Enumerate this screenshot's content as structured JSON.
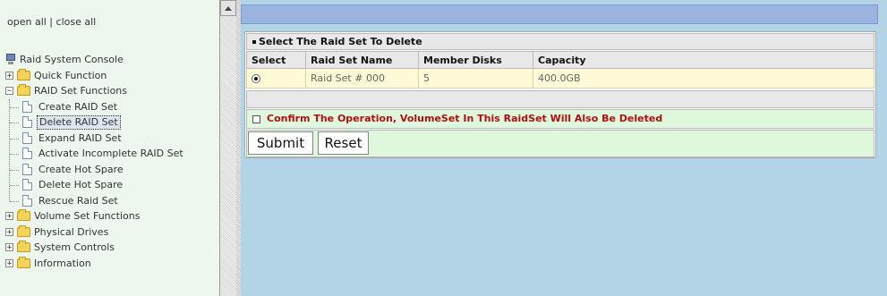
{
  "nav": {
    "open_all": "open all",
    "separator": " | ",
    "close_all": "close all"
  },
  "tree": {
    "root": "Raid System Console",
    "quick_function": "Quick Function",
    "raid_set_functions": "RAID Set Functions",
    "raid_items": [
      "Create RAID Set",
      "Delete RAID Set",
      "Expand RAID Set",
      "Activate Incomplete RAID Set",
      "Create Hot Spare",
      "Delete Hot Spare",
      "Rescue Raid Set"
    ],
    "volume_set_functions": "Volume Set Functions",
    "physical_drives": "Physical Drives",
    "system_controls": "System Controls",
    "information": "Information"
  },
  "panel": {
    "title": "Select The Raid Set To Delete",
    "columns": [
      "Select",
      "Raid Set Name",
      "Member Disks",
      "Capacity"
    ],
    "row": {
      "name": "Raid Set # 000",
      "member_disks": "5",
      "capacity": "400.0GB"
    },
    "confirm_text": "Confirm The Operation, VolumeSet In This RaidSet Will Also Be Deleted",
    "submit_label": "Submit",
    "reset_label": "Reset"
  },
  "colors": {
    "left_bg": "#eef7ee",
    "right_bg": "#b3d4e6",
    "warning_text": "#b01010",
    "row_bg": "#fdfbd7",
    "confirm_bg": "#dff7dd"
  }
}
